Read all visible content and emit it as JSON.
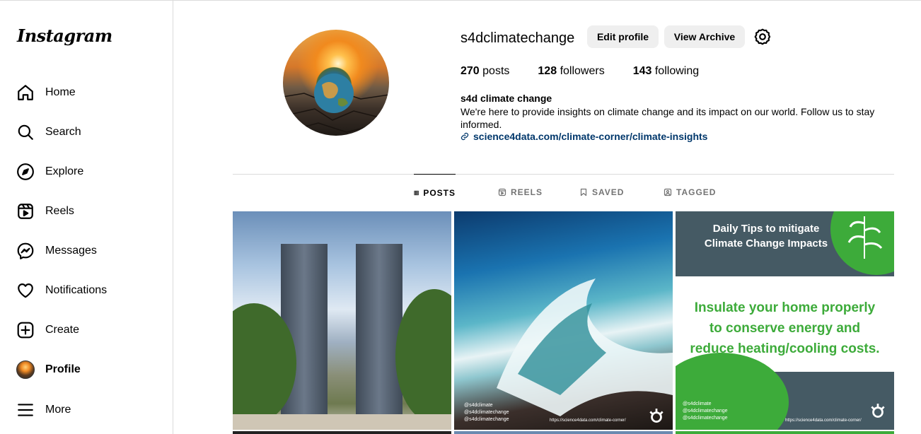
{
  "app": {
    "logo": "Instagram"
  },
  "sidebar": {
    "items": [
      {
        "label": "Home",
        "icon": "home-icon"
      },
      {
        "label": "Search",
        "icon": "search-icon"
      },
      {
        "label": "Explore",
        "icon": "compass-icon"
      },
      {
        "label": "Reels",
        "icon": "reels-icon"
      },
      {
        "label": "Messages",
        "icon": "messenger-icon"
      },
      {
        "label": "Notifications",
        "icon": "heart-icon"
      },
      {
        "label": "Create",
        "icon": "plus-square-icon"
      },
      {
        "label": "Profile",
        "icon": "avatar"
      },
      {
        "label": "More",
        "icon": "hamburger-icon"
      }
    ]
  },
  "profile": {
    "username": "s4dclimatechange",
    "edit_label": "Edit profile",
    "archive_label": "View Archive",
    "posts_count": "270",
    "posts_label": "posts",
    "followers_count": "128",
    "followers_label": "followers",
    "following_count": "143",
    "following_label": "following",
    "display_name": "s4d climate change",
    "bio": "We're here to provide insights on climate change and its impact on our world. Follow us to stay informed.",
    "link": "science4data.com/climate-corner/climate-insights"
  },
  "tabs": [
    {
      "label": "POSTS",
      "active": true
    },
    {
      "label": "REELS",
      "active": false
    },
    {
      "label": "SAVED",
      "active": false
    },
    {
      "label": "TAGGED",
      "active": false
    }
  ],
  "posts": {
    "tile3_heading_1": "Daily Tips to mitigate",
    "tile3_heading_2": "Climate Change Impacts",
    "tile3_tip_1": "Insulate your home properly",
    "tile3_tip_2": "to conserve energy and",
    "tile3_tip_3": "reduce heating/cooling costs.",
    "social_twitter": "@s4dclimate",
    "social_instagram": "@s4dclimatechange",
    "social_tiktok": "@s4dclimatechange",
    "tile2_url": "https://science4data.com/climate-corner/",
    "tile3_url": "https://science4data.com/climate-corner/"
  },
  "colors": {
    "accent_green": "#3dab3a",
    "link_blue": "#00376b",
    "tab_gray": "#737373"
  }
}
